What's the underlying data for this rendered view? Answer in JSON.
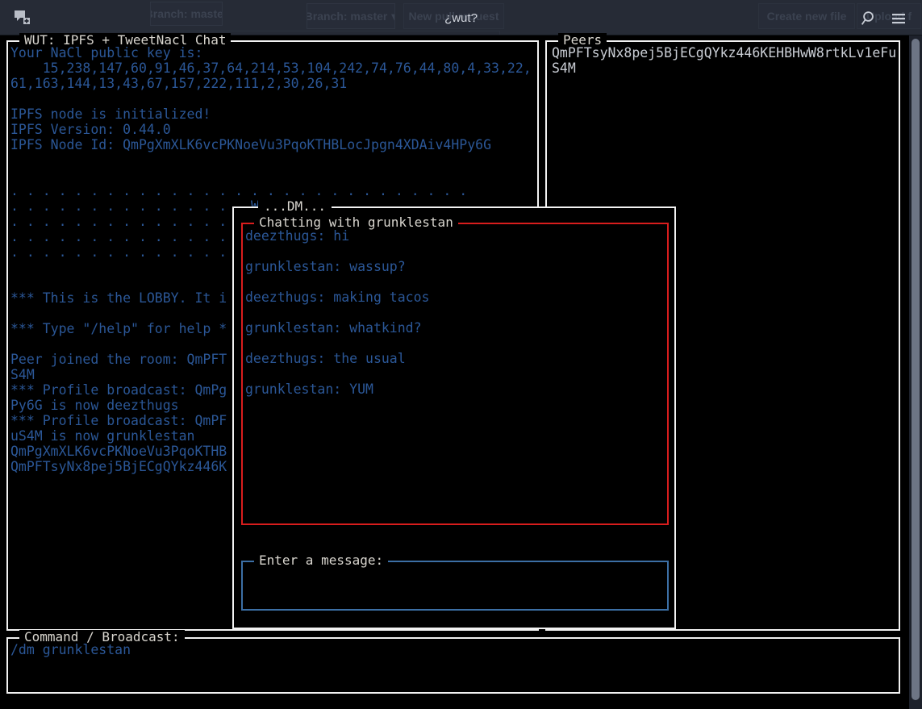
{
  "titlebar": {
    "title": "¿wut?",
    "app_icon": "chat-add-icon",
    "search_icon": "search-icon",
    "menu_icon": "hamburger-menu-icon",
    "ghost": {
      "branch_button": "Branch: master",
      "new_pull_request": "New pull request",
      "create_new_file": "Create new file",
      "upload_files": "Upload f"
    }
  },
  "main_panel": {
    "title": "WUT: IPFS + TweetNacl Chat",
    "log": "Your NaCl public key is:\n    15,238,147,60,91,46,37,64,214,53,104,242,74,76,44,80,4,33,22,\n61,163,144,13,43,67,157,222,111,2,30,26,31\n\nIPFS node is initialized!\nIPFS Version: 0.44.0\nIPFS Node Id: QmPgXmXLK6vcPKNoeVu3PqoKTHBLocJpgn4XDAiv4HPy6G\n\n\n. . . . . . . . . . . . . . . . . . . . . . . . . . . . .\n. . . . . . . . . . . . . . . Welcome . . . . . . . . . . . . .\n. . . . . . . . . . . . . . . . To . . . .\n. . . . . . . . . . . . . . . . ¿wut? . .\n. . . . . . . . . . . . . . . . . . . . . .\n\n\n*** This is the LOBBY. It i\n\n*** Type \"/help\" for help *\n\nPeer joined the room: QmPFT\nS4M\n*** Profile broadcast: QmPg\nPy6G is now deezthugs\n*** Profile broadcast: QmPF\nuS4M is now grunklestan\nQmPgXmXLK6vcPKNoeVu3PqoKTHB\nQmPFTsyNx8pej5BjECgQYkz446K"
  },
  "peers_panel": {
    "title": "Peers",
    "peers": "QmPFTsyNx8pej5BjECgQYkz446KEHBHwW8rtkLv1eFuS4M"
  },
  "dm_window": {
    "title": "...DM...",
    "chat_title": "Chatting with grunklestan",
    "messages": "deezthugs: hi\n\ngrunklestan: wassup?\n\ndeezthugs: making tacos\n\ngrunklestan: whatkind?\n\ndeezthugs: the usual\n\ngrunklestan: YUM",
    "input_title": "Enter a message:",
    "input_value": ""
  },
  "command_panel": {
    "title": "Command / Broadcast:",
    "value": "/dm grunklestan"
  },
  "colors": {
    "background": "#000000",
    "titlebar": "#262b36",
    "body_text": "#2b5797",
    "border": "#f2f2f2",
    "dm_border": "#d81d1d",
    "input_border": "#3c6fa5",
    "panel_title_text": "#d9d6cf",
    "peers_text": "#c9cdd4",
    "scrollbar": "#6d7585"
  }
}
